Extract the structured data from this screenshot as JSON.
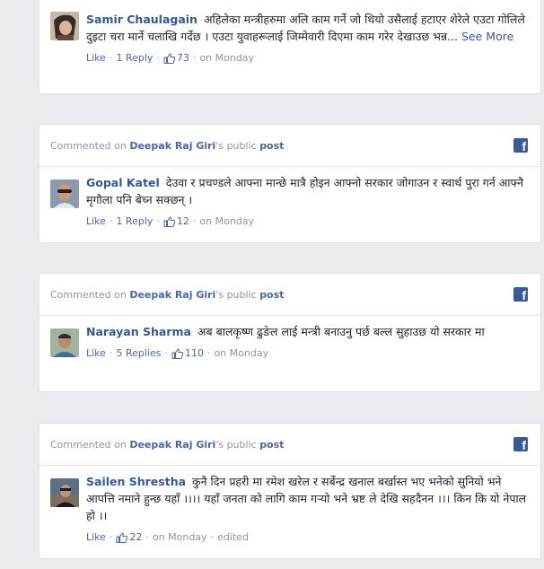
{
  "comments": [
    {
      "author": "Samir Chaulagain",
      "text": "अहिलेका मन्त्रीहरुमा अलि काम गर्ने जो थियो उसैलाई हटाएर शेरेले एउटा गोलिले दुइटा चरा मार्ने चलाखि गर्देछ । एउटा युवाहरूलाई जिम्मेवारी दिएमा काम गरेर देखाउछ भन्न...",
      "see_more": "See More",
      "like": "Like",
      "replies": "1 Reply",
      "likes_count": "73",
      "time": "on Monday"
    },
    {
      "context_prefix": "Commented on",
      "page_name": "Deepak Raj Giri",
      "context_suffix": "'s public",
      "post_label": "post",
      "author": "Gopal Katel",
      "text": "देउवा र प्रचण्डले आफ्ना मान्छे मात्रै होइन आफ्नो सरकार जोगाउन र स्वार्थ पुरा गर्न आफ्नै मृगौला पनि बेच्न सक्छन् ।",
      "like": "Like",
      "replies": "1 Reply",
      "likes_count": "12",
      "time": "on Monday"
    },
    {
      "context_prefix": "Commented on",
      "page_name": "Deepak Raj Giri",
      "context_suffix": "'s public",
      "post_label": "post",
      "author": "Narayan Sharma",
      "text": "अब बालकृष्ण ढुङेल लाई मन्त्री बनाउनु पर्छ बल्ल सुहाउछ यो सरकार मा",
      "like": "Like",
      "replies": "5 Replies",
      "likes_count": "110",
      "time": "on Monday"
    },
    {
      "context_prefix": "Commented on",
      "page_name": "Deepak Raj Giri",
      "context_suffix": "'s public",
      "post_label": "post",
      "author": "Sailen Shrestha",
      "text": "कुनै दिन प्रहरी मा रमेश खरेल र सर्बेन्द्र खनाल बर्खास्त भए भनेको सुनियो भने आपत्ति नमाने हुन्छ यहाँ ।।।। यहाँ जनता को लागि काम गऱ्यो भने भ्रष्ट ले देखि सहदैनन ।।। किन कि यो नेपाल हो ।।",
      "like": "Like",
      "likes_count": "22",
      "time": "on Monday",
      "edited": "edited"
    }
  ],
  "icons": {
    "facebook": "facebook-icon",
    "like_thumb": "thumbs-up-icon"
  },
  "colors": {
    "link_blue": "#365899",
    "fb_blue": "#3b5998",
    "meta_grey": "#90949c",
    "background": "#e9ebee"
  }
}
